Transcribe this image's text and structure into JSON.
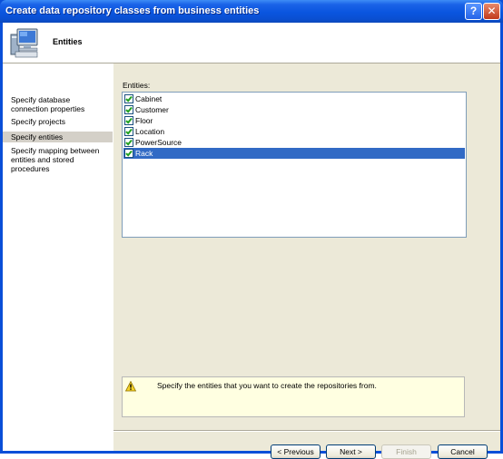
{
  "window": {
    "title": "Create data repository classes from business entities"
  },
  "header": {
    "title": "Entities",
    "icon": "computer-icon"
  },
  "sidebar": {
    "items": [
      {
        "label": "Specify database connection properties",
        "lines": [
          "Specify database",
          "connection properties"
        ],
        "selected": false
      },
      {
        "label": "Specify projects",
        "lines": [
          "Specify projects"
        ],
        "selected": false
      },
      {
        "label": "Specify entities",
        "lines": [
          "Specify entities"
        ],
        "selected": true
      },
      {
        "label": "Specify mapping between entities and stored procedures",
        "lines": [
          "Specify mapping between",
          "entities and stored",
          "procedures"
        ],
        "selected": false
      }
    ]
  },
  "main": {
    "entities_label": "Entities:",
    "entities": [
      {
        "name": "Cabinet",
        "checked": true,
        "selected": false
      },
      {
        "name": "Customer",
        "checked": true,
        "selected": false
      },
      {
        "name": "Floor",
        "checked": true,
        "selected": false
      },
      {
        "name": "Location",
        "checked": true,
        "selected": false
      },
      {
        "name": "PowerSource",
        "checked": true,
        "selected": false
      },
      {
        "name": "Rack",
        "checked": true,
        "selected": true
      }
    ],
    "info_text": "Specify the entities that you want to create the repositories from."
  },
  "buttons": {
    "previous": "< Previous",
    "next": "Next >",
    "finish": "Finish",
    "cancel": "Cancel"
  },
  "colors": {
    "title_bar": "#0a55df",
    "selection": "#316ac5",
    "info_bg": "#ffffe1"
  }
}
